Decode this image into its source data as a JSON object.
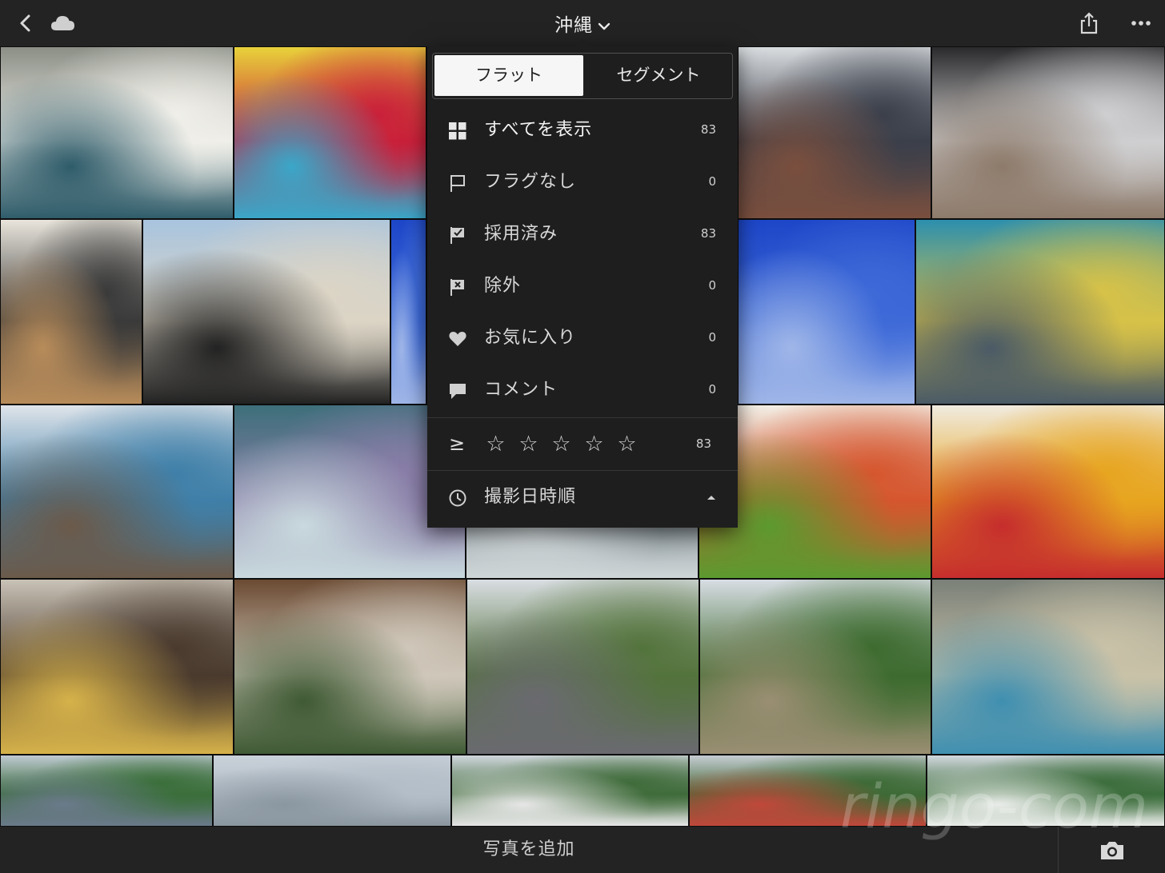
{
  "header": {
    "title": "沖縄",
    "icons": [
      "chevron-left-icon",
      "cloud-icon",
      "chevron-down-icon",
      "share-icon",
      "more-icon"
    ]
  },
  "filter_popup": {
    "segment": {
      "active": "フラット",
      "inactive": "セグメント"
    },
    "items": [
      {
        "icon": "grid-icon",
        "label": "すべてを表示",
        "count": "83"
      },
      {
        "icon": "flag-outline-icon",
        "label": "フラグなし",
        "count": "0"
      },
      {
        "icon": "flag-pick-icon",
        "label": "採用済み",
        "count": "83"
      },
      {
        "icon": "flag-reject-icon",
        "label": "除外",
        "count": "0"
      },
      {
        "icon": "heart-icon",
        "label": "お気に入り",
        "count": "0"
      },
      {
        "icon": "comment-icon",
        "label": "コメント",
        "count": "0"
      }
    ],
    "rating": {
      "operator": "≥",
      "stars": [
        "☆",
        "☆",
        "☆",
        "☆",
        "☆"
      ],
      "count": "83"
    },
    "sort": {
      "icon": "clock-icon",
      "label": "撮影日時順"
    }
  },
  "photos": [
    {
      "name": "photo-train-seat",
      "colors": [
        "#8b8f86",
        "#f0efe9",
        "#2f5c6a"
      ]
    },
    {
      "name": "photo-luggage-sizer",
      "colors": [
        "#e8d23a",
        "#c9203a",
        "#3aa7c9"
      ]
    },
    {
      "name": "photo-airport-shop",
      "colors": [
        "#d9dde0",
        "#3b3f4a",
        "#7a4f3e"
      ]
    },
    {
      "name": "photo-travelers-coffee",
      "colors": [
        "#2a2a2c",
        "#cfcfd1",
        "#8d7a6a"
      ]
    },
    {
      "name": "photo-menu-board",
      "colors": [
        "#e9e5dc",
        "#3a3a3a",
        "#b88c5a"
      ]
    },
    {
      "name": "photo-airport-lounge",
      "colors": [
        "#a8c4de",
        "#dcd5c6",
        "#222222"
      ]
    },
    {
      "name": "photo-sky-wing",
      "colors": [
        "#1d46c8",
        "#3e6ad8",
        "#9fb6e8"
      ]
    },
    {
      "name": "photo-aquarium-kids",
      "colors": [
        "#2c8fae",
        "#d7c248",
        "#4a5a66"
      ]
    },
    {
      "name": "photo-mall-aquarium",
      "colors": [
        "#dfe4ea",
        "#3f7fa8",
        "#6b5a4a"
      ]
    },
    {
      "name": "photo-aquarium-tank",
      "colors": [
        "#3d6f7a",
        "#8a7ea8",
        "#c9d9de"
      ]
    },
    {
      "name": "photo-aquarium-crowd",
      "colors": [
        "#3a4a44",
        "#7f8a90",
        "#cfd6d8"
      ]
    },
    {
      "name": "photo-omurice-avocado",
      "colors": [
        "#f3efe6",
        "#d5562e",
        "#5b9a2f"
      ]
    },
    {
      "name": "photo-omurice",
      "colors": [
        "#f0ebe0",
        "#e7a51f",
        "#c62d2d"
      ]
    },
    {
      "name": "photo-food-court-subway",
      "colors": [
        "#c9c2b6",
        "#4a3a2e",
        "#d6b24a"
      ]
    },
    {
      "name": "photo-food-court",
      "colors": [
        "#6b4a32",
        "#cfc7ba",
        "#3f5a34"
      ]
    },
    {
      "name": "photo-park-walk",
      "colors": [
        "#d9dde2",
        "#53733c",
        "#6a6a70"
      ]
    },
    {
      "name": "photo-beach-parking",
      "colors": [
        "#d8dde4",
        "#3d6b2f",
        "#9a8e72"
      ]
    },
    {
      "name": "photo-beach-shop",
      "colors": [
        "#7a8078",
        "#c9c2a8",
        "#3f8fb0"
      ]
    },
    {
      "name": "photo-beach-people",
      "colors": [
        "#bfc9d2",
        "#3a6e3a",
        "#6a7a8a"
      ]
    },
    {
      "name": "photo-cloudy-sky",
      "colors": [
        "#c9d1d9",
        "#b4bec8",
        "#8a96a0"
      ]
    },
    {
      "name": "photo-beach-tents",
      "colors": [
        "#d0d6dc",
        "#3f6b3a",
        "#e6e6e6"
      ]
    },
    {
      "name": "photo-beach-umbrella",
      "colors": [
        "#c6ccd2",
        "#3d6a36",
        "#c0483a"
      ]
    },
    {
      "name": "photo-beach-shore",
      "colors": [
        "#d1d7dd",
        "#3c6d3c",
        "#e9ece9"
      ]
    }
  ],
  "footer": {
    "add_label": "写真を追加",
    "camera_icon": "camera-icon"
  },
  "watermark": {
    "text": "ringo-com"
  }
}
